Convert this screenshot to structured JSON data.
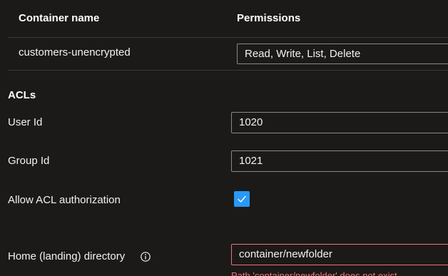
{
  "table": {
    "headers": {
      "container_name": "Container name",
      "permissions": "Permissions"
    },
    "rows": [
      {
        "container_name": "customers-unencrypted",
        "permissions": "Read, Write, List, Delete"
      }
    ]
  },
  "acls": {
    "section_title": "ACLs",
    "user_id_label": "User Id",
    "user_id_value": "1020",
    "group_id_label": "Group Id",
    "group_id_value": "1021",
    "allow_acl_label": "Allow ACL authorization",
    "allow_acl_checked": true
  },
  "home_directory": {
    "label": "Home (landing) directory",
    "value": "container/newfolder",
    "error": "Path 'container/newfolder' does not exist."
  },
  "colors": {
    "background": "#1b1a19",
    "accent": "#2899f5",
    "error": "#f1707b"
  }
}
